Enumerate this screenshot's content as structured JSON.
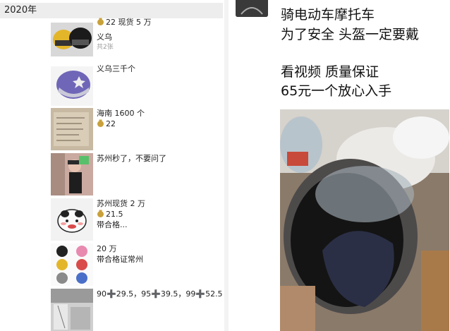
{
  "left": {
    "year": "2020年",
    "posts": [
      {
        "id": "p1",
        "lines": [
          "22 现货 5 万",
          "义乌"
        ],
        "bag_line": 0,
        "image_count": "共2张",
        "thumb": "helmets-yellow-black"
      },
      {
        "id": "p2",
        "lines": [
          "义乌三千个"
        ],
        "bag_line": -1,
        "thumb": "helmet-purple-star"
      },
      {
        "id": "p3",
        "lines": [
          "海南 1600 个",
          "22"
        ],
        "bag_line": 1,
        "thumb": "document-photo"
      },
      {
        "id": "p4",
        "lines": [
          "苏州秒了，不要问了"
        ],
        "bag_line": -1,
        "thumb": "person-photo"
      },
      {
        "id": "p5",
        "lines": [
          "苏州现货 2 万",
          "21.5",
          "带合格..."
        ],
        "bag_line": 1,
        "thumb": "sticker-face"
      },
      {
        "id": "p6",
        "lines": [
          "20 万",
          "带合格证常州"
        ],
        "bag_line": -1,
        "thumb": "helmet-grid"
      },
      {
        "id": "p7",
        "lines": [
          "90➕29.5，95➕39.5，99➕52.5"
        ],
        "bag_line": -1,
        "thumb": "warehouse-photo"
      }
    ]
  },
  "right": {
    "caption_lines": [
      "骑电动车摩托车",
      "为了安全 头盔一定要戴",
      "",
      "看视频 质量保证",
      "65元一个放心入手"
    ],
    "video_alt": "helmet video frame"
  },
  "colors": {
    "year_bar_bg": "#ededed",
    "muted": "#999999",
    "bag": "#c9a13b"
  }
}
